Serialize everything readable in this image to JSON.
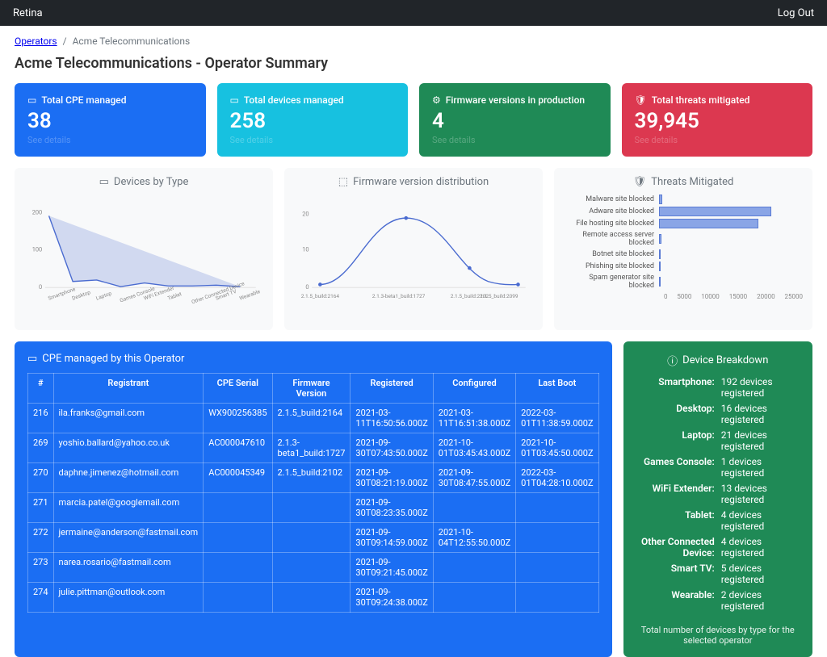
{
  "topbar": {
    "brand": "Retina",
    "logout": "Log Out"
  },
  "breadcrumb": {
    "root": "Operators",
    "current": "Acme Telecommunications"
  },
  "page_title": "Acme Telecommunications - Operator Summary",
  "cards": {
    "cpe": {
      "label": "Total CPE managed",
      "value": "38",
      "details": "See details"
    },
    "devices": {
      "label": "Total devices managed",
      "value": "258",
      "details": "See details"
    },
    "firmware": {
      "label": "Firmware versions in production",
      "value": "4",
      "details": "See details"
    },
    "threats": {
      "label": "Total threats mitigated",
      "value": "39,945",
      "details": "See details"
    }
  },
  "charts": {
    "devices_by_type": {
      "title": "Devices by Type"
    },
    "firmware_dist": {
      "title": "Firmware version distribution"
    },
    "threats": {
      "title": "Threats Mitigated"
    }
  },
  "cpe_table": {
    "title": "CPE managed by this Operator",
    "headers": [
      "#",
      "Registrant",
      "CPE Serial",
      "Firmware Version",
      "Registered",
      "Configured",
      "Last Boot"
    ],
    "rows": [
      [
        "216",
        "ila.franks@gmail.com",
        "WX900256385",
        "2.1.5_build:2164",
        "2021-03-11T16:50:56.000Z",
        "2021-03-11T16:51:38.000Z",
        "2022-03-01T11:38:59.000Z"
      ],
      [
        "269",
        "yoshio.ballard@yahoo.co.uk",
        "AC000047610",
        "2.1.3-beta1_build:1727",
        "2021-09-30T07:43:50.000Z",
        "2021-10-01T03:45:43.000Z",
        "2021-10-01T03:45:50.000Z"
      ],
      [
        "270",
        "daphne.jimenez@hotmail.com",
        "AC000045349",
        "2.1.5_build:2102",
        "2021-09-30T08:21:19.000Z",
        "2021-09-30T08:47:55.000Z",
        "2022-03-01T04:28:10.000Z"
      ],
      [
        "271",
        "marcia.patel@googlemail.com",
        "",
        "",
        "2021-09-30T08:23:35.000Z",
        "",
        ""
      ],
      [
        "272",
        "jermaine@anderson@fastmail.com",
        "",
        "",
        "2021-09-30T09:14:59.000Z",
        "2021-10-04T12:55:50.000Z",
        ""
      ],
      [
        "273",
        "narea.rosario@fastmail.com",
        "",
        "",
        "2021-09-30T09:21:45.000Z",
        "",
        ""
      ],
      [
        "274",
        "julie.pittman@outlook.com",
        "",
        "",
        "2021-09-30T09:24:38.000Z",
        "",
        ""
      ]
    ]
  },
  "breakdown": {
    "title": "Device Breakdown",
    "rows": [
      {
        "k": "Smartphone:",
        "v": "192 devices registered"
      },
      {
        "k": "Desktop:",
        "v": "16 devices registered"
      },
      {
        "k": "Laptop:",
        "v": "21 devices registered"
      },
      {
        "k": "Games Console:",
        "v": "1 devices registered"
      },
      {
        "k": "WiFi Extender:",
        "v": "13 devices registered"
      },
      {
        "k": "Tablet:",
        "v": "4 devices registered"
      },
      {
        "k": "Other Connected Device:",
        "v": "4 devices registered"
      },
      {
        "k": "Smart TV:",
        "v": "5 devices registered"
      },
      {
        "k": "Wearable:",
        "v": "2 devices registered"
      }
    ],
    "footer": "Total number of devices by type for the selected operator"
  },
  "chart_data": [
    {
      "type": "area",
      "title": "Devices by Type",
      "categories": [
        "Smartphone",
        "Desktop",
        "Laptop",
        "Games Console",
        "WiFi Extender",
        "Tablet",
        "Other Connected Device",
        "Smart TV",
        "Wearable"
      ],
      "values": [
        192,
        16,
        21,
        1,
        13,
        4,
        4,
        5,
        2
      ],
      "ylim": [
        0,
        200
      ]
    },
    {
      "type": "line",
      "title": "Firmware version distribution",
      "categories": [
        "2.1.5_build:2164",
        "2.1.3-beta1_build:1727",
        "2.1.5_build:2102",
        "2.1.5_build:2099"
      ],
      "values": [
        1,
        19,
        6,
        1
      ],
      "ylim": [
        0,
        20
      ]
    },
    {
      "type": "bar",
      "title": "Threats Mitigated",
      "orientation": "horizontal",
      "categories": [
        "Malware site blocked",
        "Adware site blocked",
        "File hosting site blocked",
        "Remote access server blocked",
        "Botnet site blocked",
        "Phishing site blocked",
        "Spam generator site blocked"
      ],
      "values": [
        600,
        20500,
        18100,
        400,
        300,
        200,
        150
      ],
      "xlim": [
        0,
        25000
      ],
      "xticks": [
        0,
        5000,
        10000,
        15000,
        20000,
        25000
      ]
    }
  ]
}
